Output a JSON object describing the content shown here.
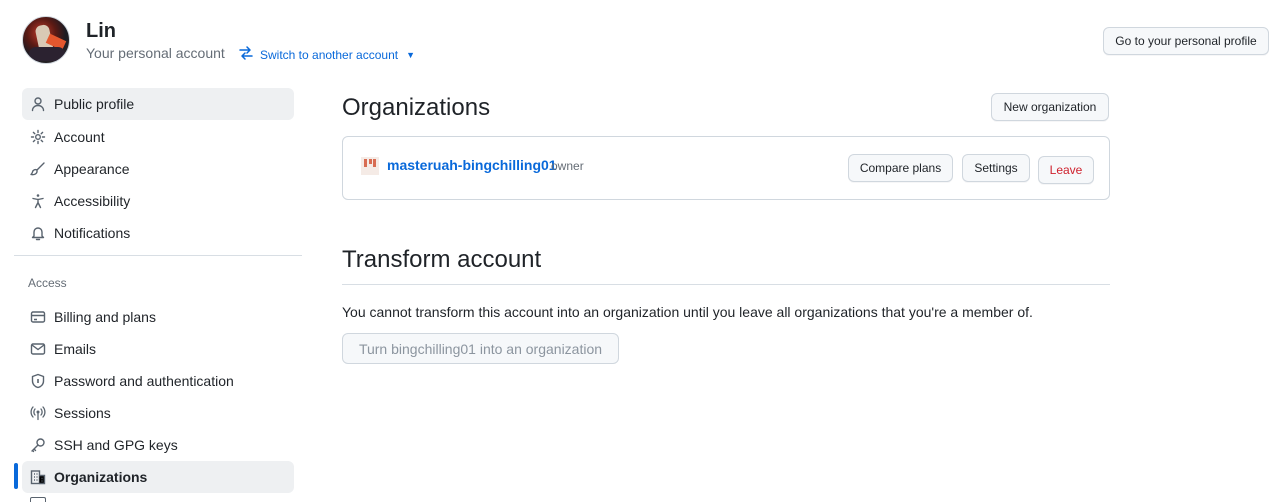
{
  "header": {
    "account_name": "Lin",
    "account_subtitle": "Your personal account",
    "switch_label": "Switch to another account",
    "profile_button": "Go to your personal profile"
  },
  "sidebar": {
    "items": [
      {
        "label": "Public profile",
        "icon": "person-icon"
      },
      {
        "label": "Account",
        "icon": "gear-icon"
      },
      {
        "label": "Appearance",
        "icon": "paintbrush-icon"
      },
      {
        "label": "Accessibility",
        "icon": "accessibility-icon"
      },
      {
        "label": "Notifications",
        "icon": "bell-icon"
      }
    ],
    "access_label": "Access",
    "access_items": [
      {
        "label": "Billing and plans",
        "icon": "credit-card-icon"
      },
      {
        "label": "Emails",
        "icon": "mail-icon"
      },
      {
        "label": "Password and authentication",
        "icon": "shield-lock-icon"
      },
      {
        "label": "Sessions",
        "icon": "broadcast-icon"
      },
      {
        "label": "SSH and GPG keys",
        "icon": "key-icon"
      },
      {
        "label": "Organizations",
        "icon": "organization-icon",
        "selected": true
      }
    ]
  },
  "main": {
    "organizations_title": "Organizations",
    "new_org_button": "New organization",
    "org": {
      "name": "masteruah-bingchilling01",
      "role": "owner",
      "compare_button": "Compare plans",
      "settings_button": "Settings",
      "leave_button": "Leave"
    },
    "transform_title": "Transform account",
    "transform_text": "You cannot transform this account into an organization until you leave all organizations that you're a member of.",
    "transform_button": "Turn bingchilling01 into an organization"
  },
  "colors": {
    "accent": "#0969da",
    "danger": "#cf222e",
    "muted": "#656d76",
    "border": "#d0d7de"
  }
}
